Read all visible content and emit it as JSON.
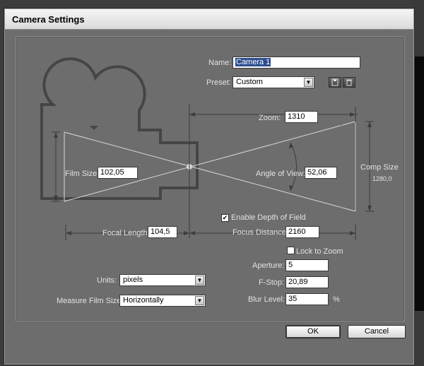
{
  "dialog": {
    "title": "Camera Settings"
  },
  "name": {
    "label": "Name:",
    "value": "Camera 1"
  },
  "preset": {
    "label": "Preset:",
    "value": "Custom"
  },
  "zoom": {
    "label": "Zoom:",
    "value": "1310"
  },
  "film_size": {
    "label": "Film Size:",
    "value": "102,05"
  },
  "angle_of_view": {
    "label": "Angle of View:",
    "value": "52,06"
  },
  "comp_size": {
    "label": "Comp Size",
    "value": "1280,0"
  },
  "depth_of_field": {
    "label": "Enable Depth of Field",
    "checked": true
  },
  "focal_length": {
    "label": "Focal Length:",
    "value": "104,5"
  },
  "focus_distance": {
    "label": "Focus Distance:",
    "value": "2160"
  },
  "lock_to_zoom": {
    "label": "Lock to Zoom",
    "checked": false
  },
  "aperture": {
    "label": "Aperture:",
    "value": "5"
  },
  "f_stop": {
    "label": "F-Stop:",
    "value": "20,89"
  },
  "blur_level": {
    "label": "Blur Level:",
    "value": "35",
    "unit": "%"
  },
  "units": {
    "label": "Units:",
    "value": "pixels"
  },
  "measure_film_size": {
    "label": "Measure Film Size:",
    "value": "Horizontally"
  },
  "buttons": {
    "ok": "OK",
    "cancel": "Cancel"
  },
  "icons": {
    "save": "save-preset-icon",
    "delete": "trash-icon",
    "check": "✔",
    "dropdown": "▼"
  }
}
